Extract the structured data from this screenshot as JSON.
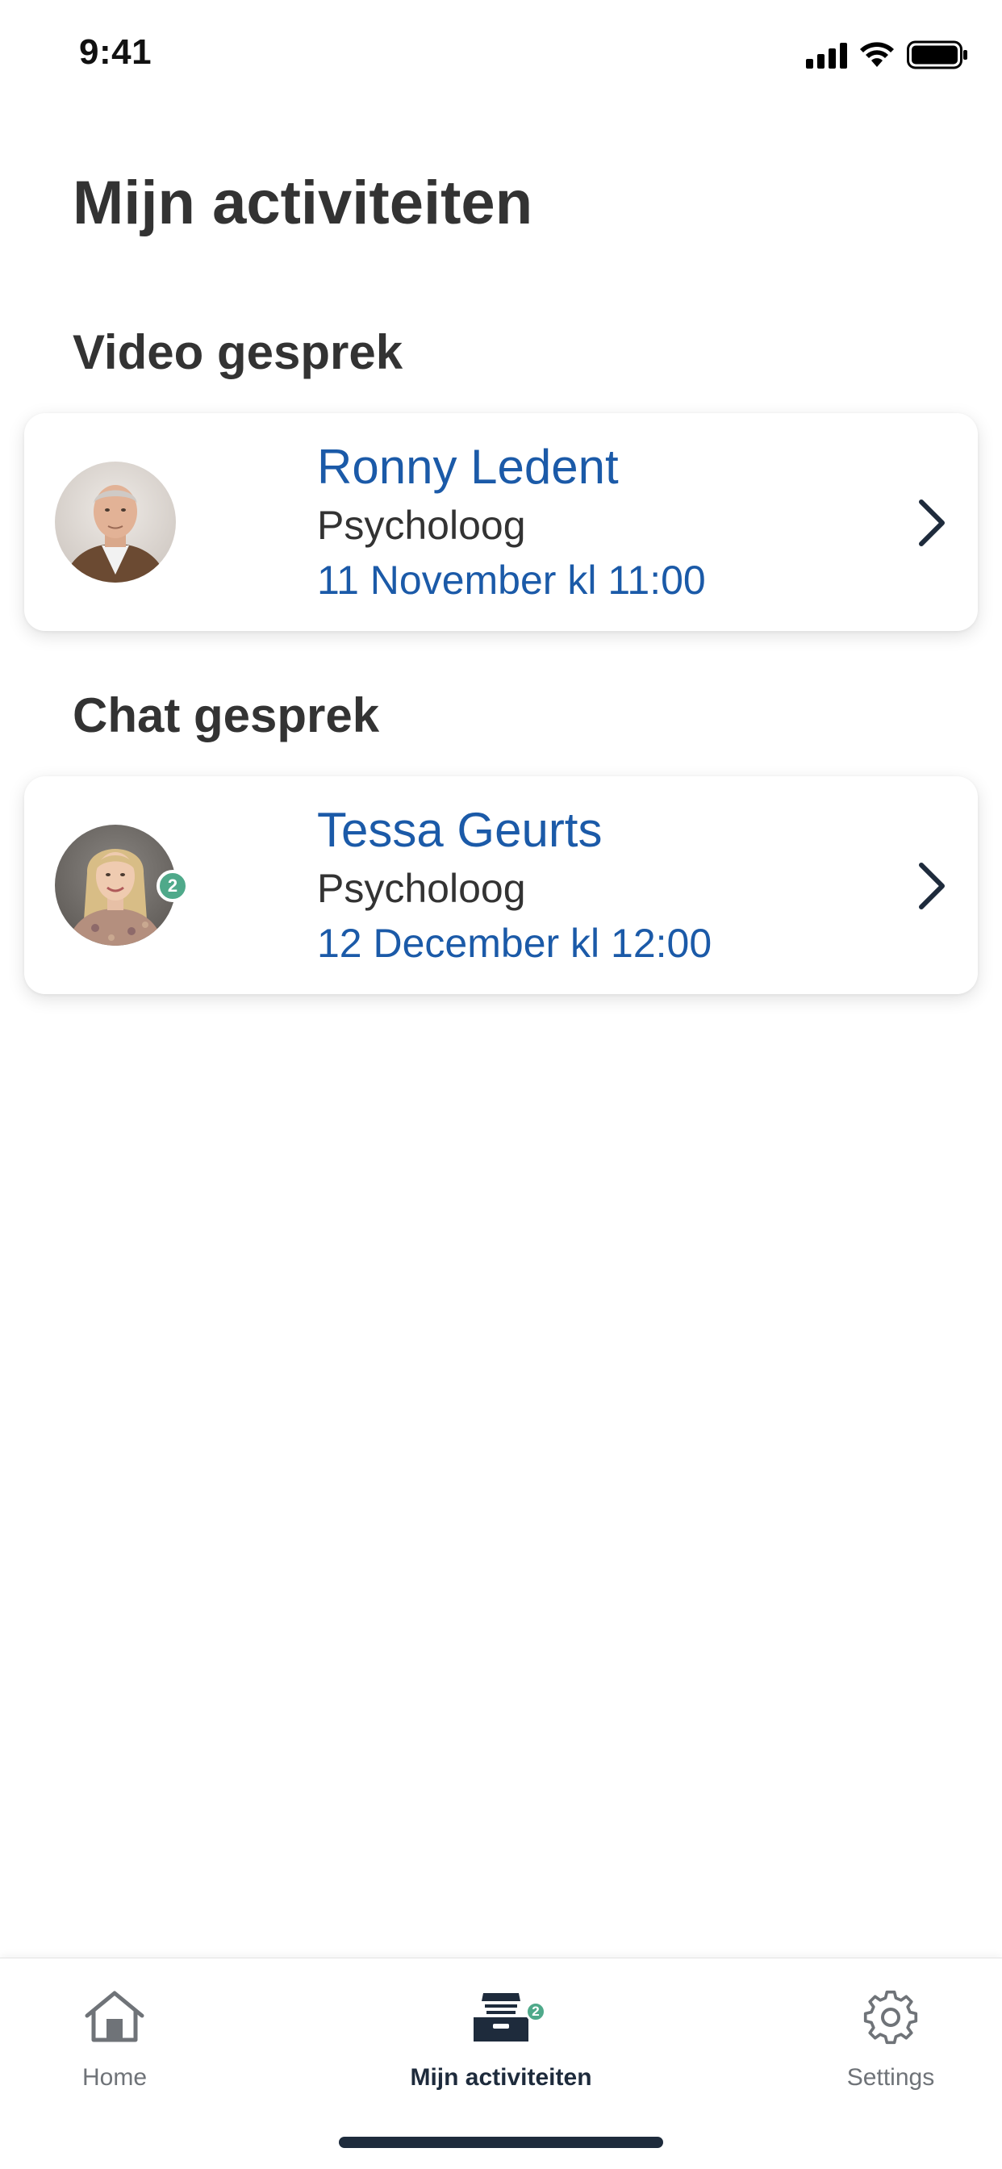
{
  "status_bar": {
    "time": "9:41"
  },
  "page_title": "Mijn activiteiten",
  "sections": [
    {
      "title": "Video gesprek",
      "card": {
        "name": "Ronny Ledent",
        "role": "Psycholoog",
        "date": "11 November kl 11:00",
        "badge": null
      }
    },
    {
      "title": "Chat gesprek",
      "card": {
        "name": "Tessa Geurts",
        "role": "Psycholoog",
        "date": "12 December kl 12:00",
        "badge": "2"
      }
    }
  ],
  "tab_bar": {
    "tabs": [
      {
        "label": "Home",
        "icon": "house-icon",
        "active": false
      },
      {
        "label": "Mijn activiteiten",
        "icon": "inbox-tray-icon",
        "active": true,
        "badge": "2"
      },
      {
        "label": "Settings",
        "icon": "gear-icon",
        "active": false
      }
    ]
  },
  "colors": {
    "accent_blue": "#1b5aa8",
    "text_dark": "#333333",
    "badge_green": "#4fa98a",
    "tab_inactive": "#6f7378",
    "tab_active": "#1e2b3c"
  }
}
